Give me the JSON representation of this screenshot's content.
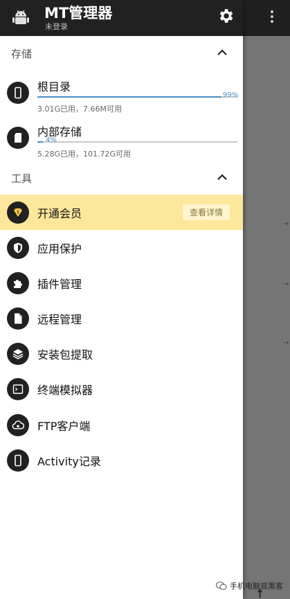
{
  "header": {
    "title": "MT管理器",
    "subtitle": "未登录"
  },
  "storage_section": {
    "title": "存储",
    "items": [
      {
        "name": "根目录",
        "info": "3.01G已用，7.66M可用",
        "percent_label": "99%",
        "percent": 99,
        "icon": "phone-icon"
      },
      {
        "name": "内部存储",
        "info": "5.28G已用，101.72G可用",
        "percent_label": "4%",
        "percent": 4,
        "icon": "sd-card-icon"
      }
    ]
  },
  "tools_section": {
    "title": "工具",
    "vip": {
      "label": "开通会员",
      "button": "查看详情",
      "icon": "vip-icon"
    },
    "items": [
      {
        "label": "应用保护",
        "icon": "shield-icon"
      },
      {
        "label": "插件管理",
        "icon": "puzzle-icon"
      },
      {
        "label": "远程管理",
        "icon": "file-icon"
      },
      {
        "label": "安装包提取",
        "icon": "layers-icon"
      },
      {
        "label": "终端模拟器",
        "icon": "terminal-icon"
      },
      {
        "label": "FTP客户端",
        "icon": "cloud-icon"
      },
      {
        "label": "Activity记录",
        "icon": "phone-icon"
      }
    ]
  },
  "watermark": "手机电脑双黑客",
  "colors": {
    "header_bg": "#212121",
    "accent": "#4a8cc4",
    "vip_bg": "#fde79a",
    "icon_circle": "#212121"
  }
}
